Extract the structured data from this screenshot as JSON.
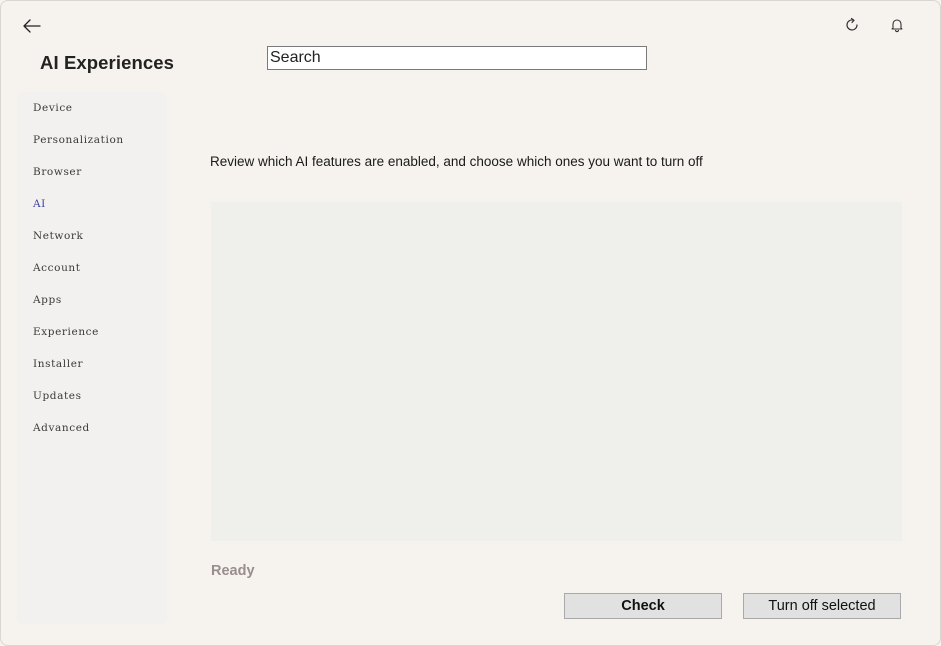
{
  "header": {
    "title": "AI Experiences",
    "back_icon": "arrow-left-icon",
    "refresh_icon": "refresh-icon",
    "notifications_icon": "bell-icon"
  },
  "search": {
    "placeholder": "Search",
    "value": ""
  },
  "sidebar": {
    "items": [
      {
        "label": "Device",
        "active": false
      },
      {
        "label": "Personalization",
        "active": false
      },
      {
        "label": "Browser",
        "active": false
      },
      {
        "label": "AI",
        "active": true
      },
      {
        "label": "Network",
        "active": false
      },
      {
        "label": "Account",
        "active": false
      },
      {
        "label": "Apps",
        "active": false
      },
      {
        "label": "Experience",
        "active": false
      },
      {
        "label": "Installer",
        "active": false
      },
      {
        "label": "Updates",
        "active": false
      },
      {
        "label": "Advanced",
        "active": false
      }
    ]
  },
  "main": {
    "description": "Review which AI features are enabled, and choose which ones you want to turn off",
    "features": [],
    "status": "Ready"
  },
  "actions": {
    "check_label": "Check",
    "turn_off_label": "Turn off selected"
  },
  "colors": {
    "background": "#f6f3ef",
    "sidebar_bg": "#f2f1f0",
    "active_item": "#3c3f9c",
    "list_bg": "#eff0ec",
    "status_text": "#9a8d8f",
    "button_bg": "#e1e1e1"
  }
}
